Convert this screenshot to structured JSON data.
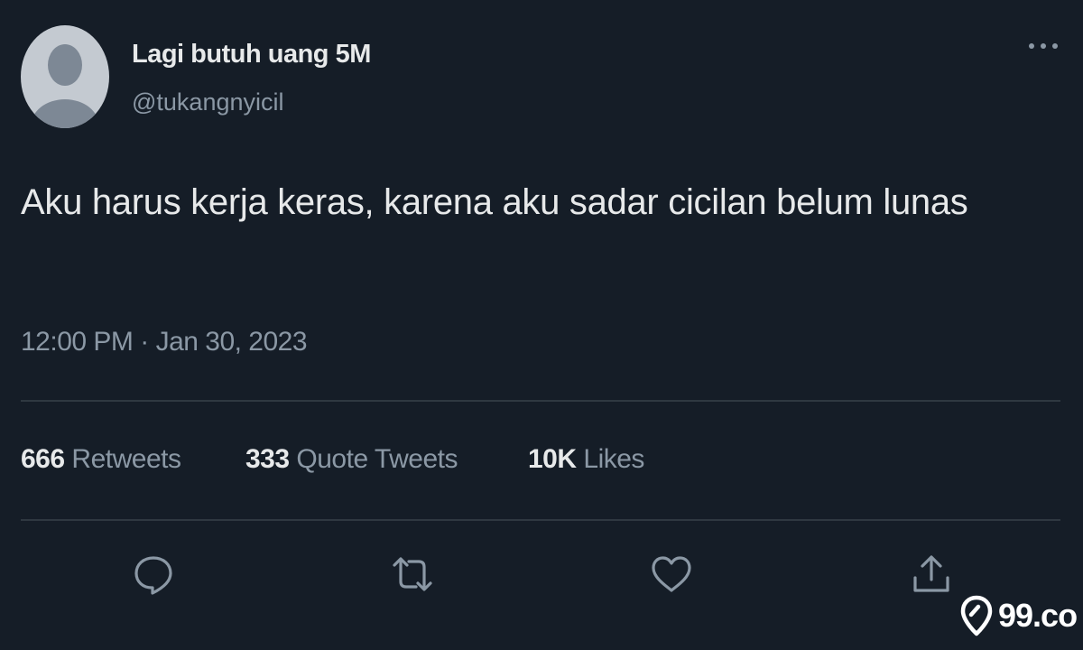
{
  "tweet": {
    "display_name": "Lagi butuh uang 5M",
    "handle": "@tukangnyicil",
    "text": "Aku harus kerja keras, karena aku sadar cicilan belum lunas",
    "timestamp": "12:00 PM · Jan 30, 2023",
    "stats": {
      "retweets_count": "666",
      "retweets_label": "Retweets",
      "quotes_count": "333",
      "quotes_label": "Quote Tweets",
      "likes_count": "10K",
      "likes_label": "Likes"
    }
  },
  "icons": {
    "more": "more-horizontal-icon",
    "reply": "reply-icon",
    "retweet": "retweet-icon",
    "like": "heart-icon",
    "share": "share-icon",
    "watermark_logo": "map-pin-icon"
  },
  "watermark": {
    "text": "99.co"
  },
  "colors": {
    "background": "#151d27",
    "primary_text": "#e7e9ea",
    "secondary_text": "#8b98a5",
    "divider": "#2f3841",
    "avatar": "#c4cad1"
  }
}
